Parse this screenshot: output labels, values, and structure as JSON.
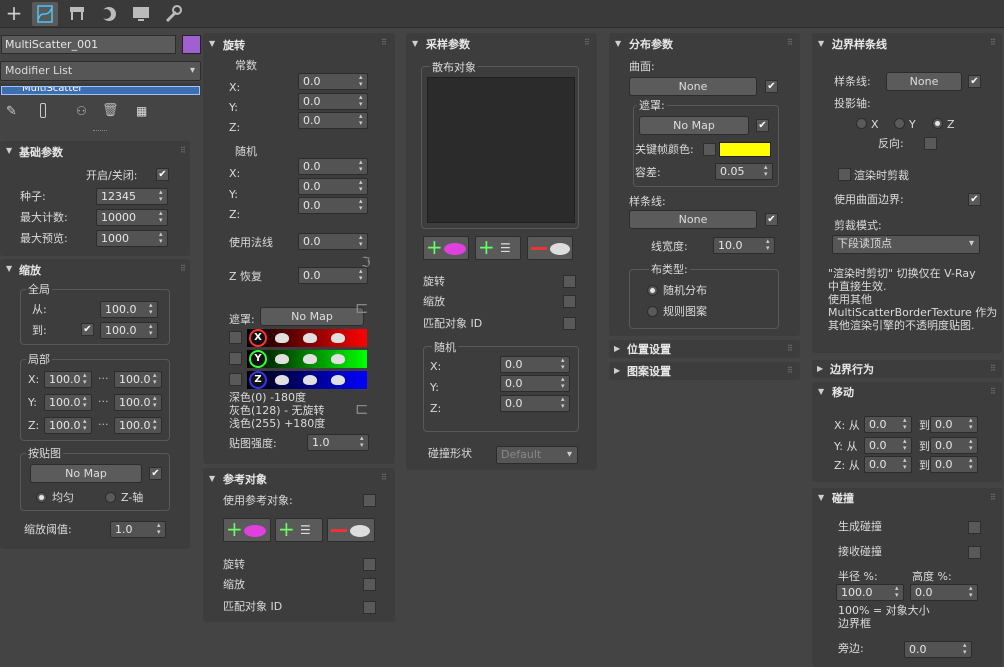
{
  "toolbar": {
    "tabs": [
      "create-tab",
      "modify-tab",
      "hierarchy-tab",
      "motion-tab",
      "display-tab",
      "utilities-tab"
    ]
  },
  "left": {
    "object_name": "MultiScatter_001",
    "object_color": "#a060d0",
    "modifier_list": "Modifier List",
    "stack_item": "MultiScatter",
    "basic": {
      "title": "基础参数",
      "onoff_label": "开启/关闭:",
      "seed_label": "种子:",
      "seed": "12345",
      "max_count_label": "最大计数:",
      "max_count": "10000",
      "max_preview_label": "最大预览:",
      "max_preview": "1000"
    },
    "scale": {
      "title": "缩放",
      "global_label": "全局",
      "from_label": "从:",
      "from": "100.0",
      "to_label": "到:",
      "to": "100.0",
      "local_label": "局部",
      "x_label": "X:",
      "y_label": "Y:",
      "z_label": "Z:",
      "xa": "100.0",
      "xb": "100.0",
      "ya": "100.0",
      "yb": "100.0",
      "za": "100.0",
      "zb": "100.0",
      "dots": "...",
      "map_label": "按贴图",
      "no_map": "No Map",
      "uniform": "均匀",
      "zaxis": "Z-轴",
      "threshold_label": "缩放阈值:",
      "threshold": "1.0"
    }
  },
  "rotation": {
    "title": "旋转",
    "const_label": "常数",
    "x": "X:",
    "y": "Y:",
    "z": "Z:",
    "cx": "0.0",
    "cy": "0.0",
    "cz": "0.0",
    "random_label": "随机",
    "rx": "0.0",
    "ry": "0.0",
    "rz": "0.0",
    "use_normal_label": "使用法线",
    "use_normal": "0.0",
    "z_restore_label": "Z 恢复",
    "z_restore": "0.0",
    "mask_label": "遮罩:",
    "no_map": "No Map",
    "letters": [
      "X",
      "Y",
      "Z"
    ],
    "dark": "深色(0)   -180度",
    "gray": "灰色(128) - 无旋转",
    "light": "浅色(255)  +180度",
    "strength_label": "贴图强度:",
    "strength": "1.0"
  },
  "reference": {
    "title": "参考对象",
    "use_label": "使用参考对象:",
    "rotation": "旋转",
    "scale": "缩放",
    "match_id": "匹配对象 ID"
  },
  "sampling": {
    "title": "采样参数",
    "scatter_objects": "散布对象",
    "rotation": "旋转",
    "scale": "缩放",
    "match_id": "匹配对象 ID",
    "random_label": "随机",
    "x": "X:",
    "y": "Y:",
    "z": "Z:",
    "rx": "0.0",
    "ry": "0.0",
    "rz": "0.0",
    "collision_label": "碰撞形状",
    "collision": "Default"
  },
  "distribution": {
    "title": "分布参数",
    "surface_label": "曲面:",
    "none": "None",
    "mask_label": "遮罩:",
    "no_map": "No Map",
    "key_color_label": "关键帧颜色:",
    "key_color": "#ffff00",
    "tolerance_label": "容差:",
    "tolerance": "0.05",
    "spline_label": "样条线:",
    "spline_none": "None",
    "spline_width_label": "线宽度:",
    "spline_width": "10.0",
    "dist_type_label": "布类型:",
    "random_dist": "随机分布",
    "regular": "规则图案"
  },
  "position_settings": "位置设置",
  "pattern_settings": "图案设置",
  "border": {
    "title": "边界样条线",
    "spline_label": "样条线:",
    "none": "None",
    "proj_label": "投影轴:",
    "x": "X",
    "y": "Y",
    "z": "Z",
    "reverse_label": "反向:",
    "clip_label": "渲染时剪裁",
    "use_surface_label": "使用曲面边界:",
    "clip_mode_label": "剪裁模式:",
    "clip_mode": "下段读顶点",
    "note1": "\"渲染时剪切\" 切换仅在 V-Ray",
    "note2": "中直接生效.",
    "note3": "使用其他",
    "note4": "MultiScatterBorderTexture 作为",
    "note5": "其他渲染引擎的不透明度贴图."
  },
  "border_behavior": "边界行为",
  "move": {
    "title": "移动",
    "x": "X: 从",
    "y": "Y: 从",
    "z": "Z: 从",
    "to": "到",
    "xa": "0.0",
    "xb": "0.0",
    "ya": "0.0",
    "yb": "0.0",
    "za": "0.0",
    "zb": "0.0"
  },
  "collision": {
    "title": "碰撞",
    "generate": "生成碰撞",
    "receive": "接收碰撞",
    "radius_label": "半径 %:",
    "height_label": "高度 %:",
    "radius": "100.0",
    "height": "0.0",
    "note1": "100% = 对象大小",
    "note2": "边界框",
    "bottom_label": "旁边:",
    "bottom": "0.0"
  }
}
